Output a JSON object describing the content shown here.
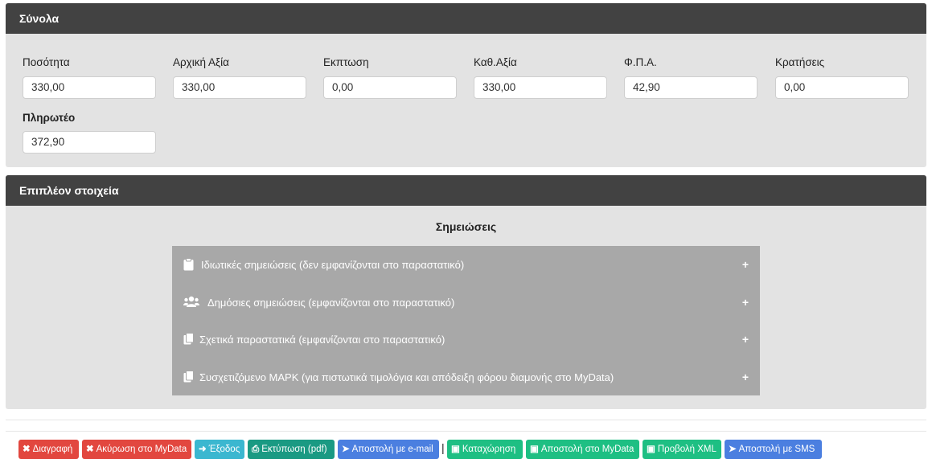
{
  "totals": {
    "title": "Σύνολα",
    "fields": [
      {
        "label": "Ποσότητα",
        "value": "330,00"
      },
      {
        "label": "Αρχική Αξία",
        "value": "330,00"
      },
      {
        "label": "Εκπτωση",
        "value": "0,00"
      },
      {
        "label": "Καθ.Αξία",
        "value": "330,00"
      },
      {
        "label": "Φ.Π.Α.",
        "value": "42,90"
      },
      {
        "label": "Κρατήσεις",
        "value": "0,00"
      }
    ],
    "payable": {
      "label": "Πληρωτέο",
      "value": "372,90"
    }
  },
  "extra": {
    "title": "Επιπλέον στοιχεία",
    "notes_title": "Σημειώσεις",
    "rows": [
      {
        "label": "Ιδιωτικές σημειώσεις (δεν εμφανίζονται στο παραστατικό)",
        "icon": "clipboard-icon",
        "toggle": "+"
      },
      {
        "label": "Δημόσιες σημειώσεις (εμφανίζονται στο παραστατικό)",
        "icon": "users-icon",
        "toggle": "+"
      },
      {
        "label": "Σχετικά παραστατικά (εμφανίζονται στο παραστατικό)",
        "icon": "copy-icon",
        "toggle": "+"
      },
      {
        "label": "Συσχετιζόμενο ΜΑΡΚ (για πιστωτικά τιμολόγια και απόδειξη φόρου διαμονής στο MyData)",
        "icon": "copy-icon",
        "toggle": "+"
      }
    ]
  },
  "actions": {
    "separator": "|",
    "buttons": [
      {
        "label": "Διαγραφή",
        "icon": "x-icon",
        "color": "#e2473f"
      },
      {
        "label": "Ακύρωση στο MyData",
        "icon": "x-icon",
        "color": "#e2473f"
      },
      {
        "label": "Έξοδος",
        "icon": "sign-out-icon",
        "color": "#3bb7d0"
      },
      {
        "label": "Εκτύπωση (pdf)",
        "icon": "print-icon",
        "color": "#1a9a83"
      },
      {
        "label": "Αποστολή με e-mail",
        "icon": "send-icon",
        "color": "#4b7fe0"
      },
      {
        "label": "Καταχώρηση",
        "icon": "save-icon",
        "color": "#1ebf83"
      },
      {
        "label": "Αποστολή στο MyData",
        "icon": "save-icon",
        "color": "#1ebf83"
      },
      {
        "label": "Προβολή XML",
        "icon": "save-icon",
        "color": "#1ebf83"
      },
      {
        "label": "Αποστολή με SMS",
        "icon": "send-icon",
        "color": "#4b7fe0"
      }
    ]
  }
}
